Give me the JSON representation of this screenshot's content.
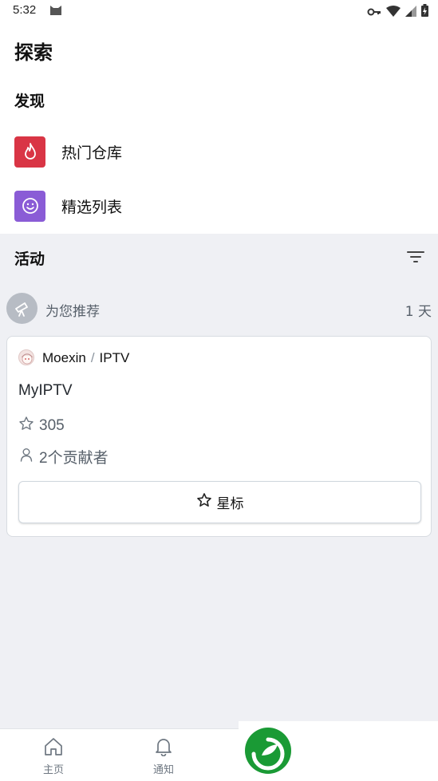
{
  "status_bar": {
    "time": "5:32"
  },
  "header": {
    "title": "探索"
  },
  "discover": {
    "title": "发现",
    "items": [
      {
        "label": "热门仓库",
        "icon": "flame-icon",
        "color": "#d93545"
      },
      {
        "label": "精选列表",
        "icon": "smiley-icon",
        "color": "#8a5cd6"
      }
    ]
  },
  "activity": {
    "title": "活动",
    "recommendation": {
      "label": "为您推荐",
      "time": "1 天"
    },
    "card": {
      "owner": "Moexin",
      "separator": "/",
      "repo": "IPTV",
      "description": "MyIPTV",
      "stars": "305",
      "contributors": "2个贡献者",
      "star_button": "星标"
    }
  },
  "bottom_nav": {
    "items": [
      {
        "label": "主页",
        "icon": "home-icon"
      },
      {
        "label": "通知",
        "icon": "bell-icon"
      }
    ]
  },
  "colors": {
    "background": "#eff0f4",
    "hot_repos": "#d93545",
    "featured_lists": "#8a5cd6",
    "logo_green": "#1a9a35"
  }
}
